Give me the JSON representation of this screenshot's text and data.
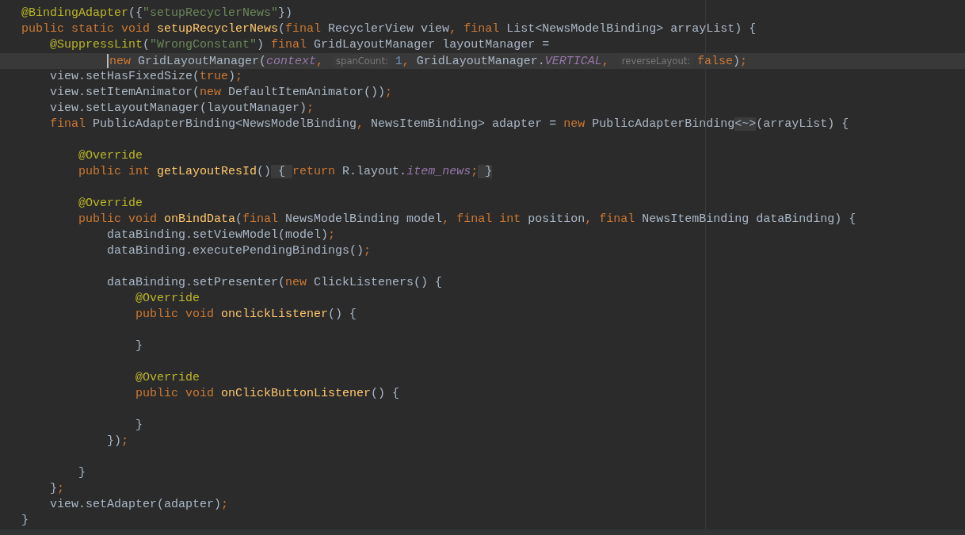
{
  "editor": {
    "lines": [
      {
        "selected": false,
        "tokens": [
          {
            "kind": "ann",
            "text": "@BindingAdapter"
          },
          {
            "kind": "plain",
            "text": "({"
          },
          {
            "kind": "str",
            "text": "\"setupRecyclerNews\""
          },
          {
            "kind": "plain",
            "text": "})"
          }
        ]
      },
      {
        "selected": false,
        "tokens": [
          {
            "kind": "kw",
            "text": "public static void "
          },
          {
            "kind": "decl",
            "text": "setupRecyclerNews"
          },
          {
            "kind": "plain",
            "text": "("
          },
          {
            "kind": "kw",
            "text": "final "
          },
          {
            "kind": "plain",
            "text": "RecyclerView view"
          },
          {
            "kind": "kw",
            "text": ", final "
          },
          {
            "kind": "plain",
            "text": "List<NewsModelBinding> arrayList) {"
          }
        ]
      },
      {
        "selected": false,
        "tokens": [
          {
            "kind": "ann",
            "text": "    @SuppressLint"
          },
          {
            "kind": "plain",
            "text": "("
          },
          {
            "kind": "str",
            "text": "\"WrongConstant\""
          },
          {
            "kind": "plain",
            "text": ") "
          },
          {
            "kind": "kw",
            "text": "final "
          },
          {
            "kind": "plain",
            "text": "GridLayoutManager layoutManager ="
          }
        ]
      },
      {
        "selected": true,
        "tokens": [
          {
            "kind": "caret"
          },
          {
            "kind": "kw",
            "text": "            new "
          },
          {
            "kind": "plain",
            "text": "GridLayoutManager("
          },
          {
            "kind": "field",
            "text": "context"
          },
          {
            "kind": "kw",
            "text": ", "
          },
          {
            "kind": "hint",
            "text": "spanCount:"
          },
          {
            "kind": "num",
            "text": "1"
          },
          {
            "kind": "kw",
            "text": ", "
          },
          {
            "kind": "plain",
            "text": "GridLayoutManager."
          },
          {
            "kind": "field",
            "text": "VERTICAL"
          },
          {
            "kind": "kw",
            "text": ", "
          },
          {
            "kind": "hint",
            "text": "reverseLayout:"
          },
          {
            "kind": "kw",
            "text": "false"
          },
          {
            "kind": "plain",
            "text": ")"
          },
          {
            "kind": "kw",
            "text": ";"
          }
        ]
      },
      {
        "selected": false,
        "tokens": [
          {
            "kind": "plain",
            "text": "    view.setHasFixedSize("
          },
          {
            "kind": "kw",
            "text": "true"
          },
          {
            "kind": "plain",
            "text": ")"
          },
          {
            "kind": "kw",
            "text": ";"
          }
        ]
      },
      {
        "selected": false,
        "tokens": [
          {
            "kind": "plain",
            "text": "    view.setItemAnimator("
          },
          {
            "kind": "kw",
            "text": "new "
          },
          {
            "kind": "plain",
            "text": "DefaultItemAnimator())"
          },
          {
            "kind": "kw",
            "text": ";"
          }
        ]
      },
      {
        "selected": false,
        "tokens": [
          {
            "kind": "plain",
            "text": "    view.setLayoutManager(layoutManager)"
          },
          {
            "kind": "kw",
            "text": ";"
          }
        ]
      },
      {
        "selected": false,
        "tokens": [
          {
            "kind": "kw",
            "text": "    final "
          },
          {
            "kind": "plain",
            "text": "PublicAdapterBinding<NewsModelBinding"
          },
          {
            "kind": "kw",
            "text": ", "
          },
          {
            "kind": "plain",
            "text": "NewsItemBinding> adapter = "
          },
          {
            "kind": "kw",
            "text": "new "
          },
          {
            "kind": "plain",
            "text": "PublicAdapterBinding"
          },
          {
            "kind": "fold",
            "text": "<~>"
          },
          {
            "kind": "plain",
            "text": "(arrayList) {"
          }
        ]
      },
      {
        "selected": false
      },
      {
        "selected": false,
        "tokens": [
          {
            "kind": "ann",
            "text": "        @Override"
          }
        ]
      },
      {
        "selected": false,
        "tokens": [
          {
            "kind": "kw",
            "text": "        public int "
          },
          {
            "kind": "decl",
            "text": "getLayoutResId"
          },
          {
            "kind": "plain",
            "text": "()"
          },
          {
            "kind": "fold",
            "text": " { "
          },
          {
            "kind": "kw",
            "text": "return "
          },
          {
            "kind": "plain",
            "text": "R.layout."
          },
          {
            "kind": "field",
            "text": "item_news"
          },
          {
            "kind": "kw",
            "text": ";"
          },
          {
            "kind": "fold",
            "text": " }"
          }
        ]
      },
      {
        "selected": false
      },
      {
        "selected": false,
        "tokens": [
          {
            "kind": "ann",
            "text": "        @Override"
          }
        ]
      },
      {
        "selected": false,
        "tokens": [
          {
            "kind": "kw",
            "text": "        public void "
          },
          {
            "kind": "decl",
            "text": "onBindData"
          },
          {
            "kind": "plain",
            "text": "("
          },
          {
            "kind": "kw",
            "text": "final "
          },
          {
            "kind": "plain",
            "text": "NewsModelBinding model"
          },
          {
            "kind": "kw",
            "text": ", final int "
          },
          {
            "kind": "plain",
            "text": "position"
          },
          {
            "kind": "kw",
            "text": ", final "
          },
          {
            "kind": "plain",
            "text": "NewsItemBinding dataBinding) {"
          }
        ]
      },
      {
        "selected": false,
        "tokens": [
          {
            "kind": "plain",
            "text": "            dataBinding.setViewModel(model)"
          },
          {
            "kind": "kw",
            "text": ";"
          }
        ]
      },
      {
        "selected": false,
        "tokens": [
          {
            "kind": "plain",
            "text": "            dataBinding.executePendingBindings()"
          },
          {
            "kind": "kw",
            "text": ";"
          }
        ]
      },
      {
        "selected": false
      },
      {
        "selected": false,
        "tokens": [
          {
            "kind": "plain",
            "text": "            dataBinding.setPresenter("
          },
          {
            "kind": "kw",
            "text": "new "
          },
          {
            "kind": "plain",
            "text": "ClickListeners() {"
          }
        ]
      },
      {
        "selected": false,
        "tokens": [
          {
            "kind": "ann",
            "text": "                @Override"
          }
        ]
      },
      {
        "selected": false,
        "tokens": [
          {
            "kind": "kw",
            "text": "                public void "
          },
          {
            "kind": "decl",
            "text": "onclickListener"
          },
          {
            "kind": "plain",
            "text": "() {"
          }
        ]
      },
      {
        "selected": false
      },
      {
        "selected": false,
        "tokens": [
          {
            "kind": "plain",
            "text": "                }"
          }
        ]
      },
      {
        "selected": false
      },
      {
        "selected": false,
        "tokens": [
          {
            "kind": "ann",
            "text": "                @Override"
          }
        ]
      },
      {
        "selected": false,
        "tokens": [
          {
            "kind": "kw",
            "text": "                public void "
          },
          {
            "kind": "decl",
            "text": "onClickButtonListener"
          },
          {
            "kind": "plain",
            "text": "() {"
          }
        ]
      },
      {
        "selected": false
      },
      {
        "selected": false,
        "tokens": [
          {
            "kind": "plain",
            "text": "                }"
          }
        ]
      },
      {
        "selected": false,
        "tokens": [
          {
            "kind": "plain",
            "text": "            })"
          },
          {
            "kind": "kw",
            "text": ";"
          }
        ]
      },
      {
        "selected": false
      },
      {
        "selected": false,
        "tokens": [
          {
            "kind": "plain",
            "text": "        }"
          }
        ]
      },
      {
        "selected": false,
        "tokens": [
          {
            "kind": "plain",
            "text": "    }"
          },
          {
            "kind": "kw",
            "text": ";"
          }
        ]
      },
      {
        "selected": false,
        "tokens": [
          {
            "kind": "plain",
            "text": "    view.setAdapter(adapter)"
          },
          {
            "kind": "kw",
            "text": ";"
          }
        ]
      },
      {
        "selected": false,
        "tokens": [
          {
            "kind": "plain",
            "text": "}"
          }
        ]
      }
    ]
  }
}
